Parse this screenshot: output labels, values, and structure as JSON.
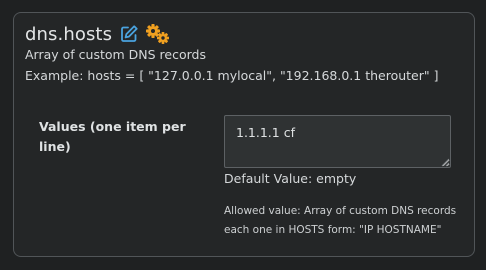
{
  "setting": {
    "name": "dns.hosts",
    "description": "Array of custom DNS records",
    "example": "Example: hosts = [ \"127.0.0.1 mylocal\", \"192.168.0.1 therouter\" ]",
    "field_label": "Values (one item per line)",
    "value": "1.1.1.1 cf",
    "default_value": "Default Value: empty",
    "allowed_line1": "Allowed value: Array of custom DNS records",
    "allowed_line2": "each one in HOSTS form: \"IP HOSTNAME\""
  },
  "icons": {
    "edit": "edit-icon",
    "advanced": "gears-icon"
  },
  "colors": {
    "accent_blue": "#4aa3df",
    "gears_orange": "#f0a020",
    "background": "#242627",
    "border": "#515558"
  }
}
